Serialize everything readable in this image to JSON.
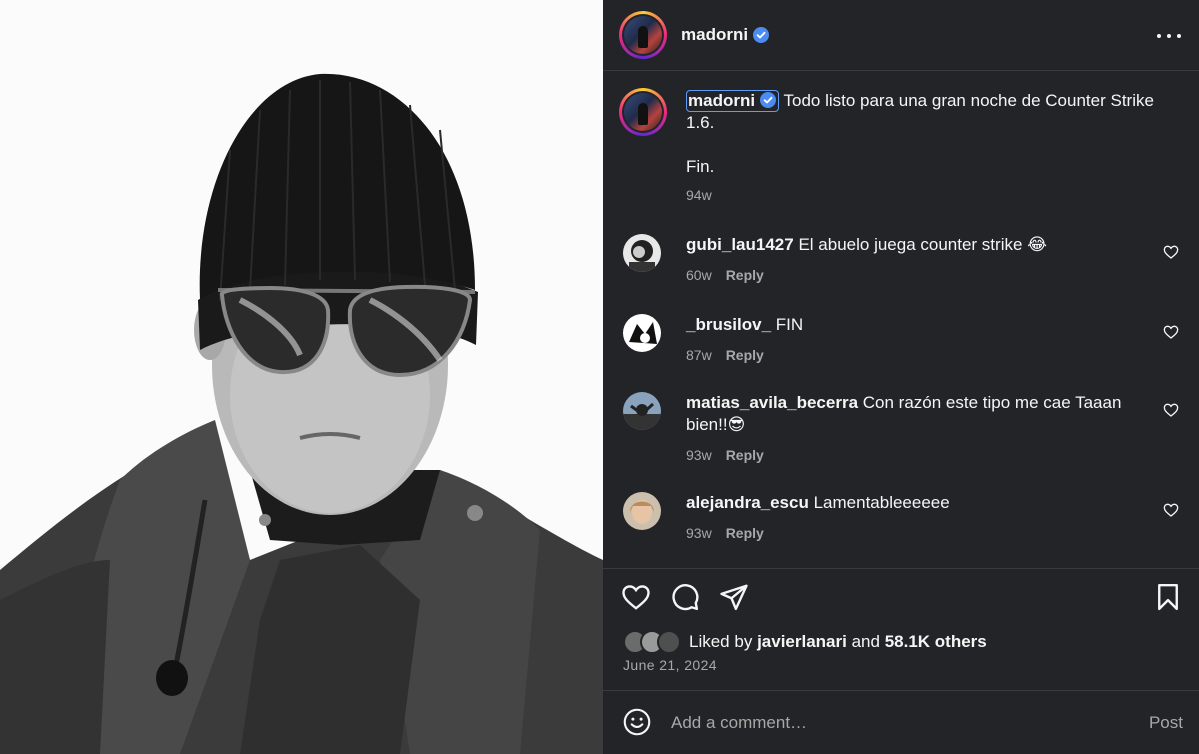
{
  "post": {
    "author": "madorni",
    "verified": true
  },
  "caption": {
    "username": "madorni",
    "text": "Todo listo para una gran noche de Counter Strike 1.6.",
    "text2": "Fin.",
    "time": "94w"
  },
  "comments": [
    {
      "username": "gubi_lau1427",
      "text": "El abuelo juega counter strike 😂",
      "time": "60w",
      "reply": "Reply"
    },
    {
      "username": "_brusilov_",
      "text": "FIN",
      "time": "87w",
      "reply": "Reply"
    },
    {
      "username": "matias_avila_becerra",
      "text": "Con razón este tipo me cae Taaan bien!!😎",
      "time": "93w",
      "reply": "Reply"
    },
    {
      "username": "alejandra_escu",
      "text": "Lamentableeeeee",
      "time": "93w",
      "reply": "Reply"
    }
  ],
  "likes": {
    "prefix": "Liked by",
    "user": "javierlanari",
    "and": "and",
    "others": "58.1K others"
  },
  "date": "June 21, 2024",
  "add_comment": {
    "placeholder": "Add a comment…",
    "post_label": "Post"
  },
  "icons": {
    "like": "heart-icon",
    "comment": "comment-bubble-icon",
    "share": "paper-plane-icon",
    "save": "bookmark-icon",
    "more": "more-options-icon",
    "emoji": "emoji-icon",
    "verified": "verified-badge-icon"
  },
  "colors": {
    "panel_bg": "#232428",
    "verified_blue": "#4c8cf0",
    "secondary_text": "#a8a8a8"
  }
}
